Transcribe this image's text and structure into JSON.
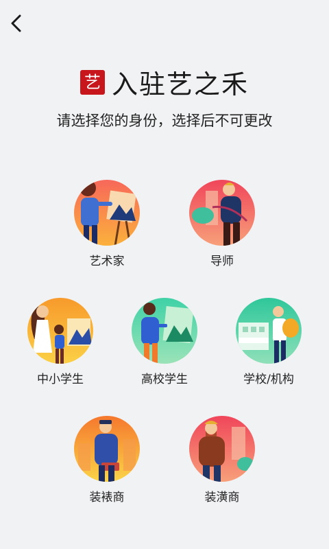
{
  "header": {
    "back_icon": "chevron-left-icon"
  },
  "brand": {
    "logo_char": "艺",
    "title": "入驻艺之禾",
    "logo_color": "#c8161d"
  },
  "subtitle": "请选择您的身份，选择后不可更改",
  "roles": [
    {
      "label": "艺术家"
    },
    {
      "label": "导师"
    },
    {
      "label": "中小学生"
    },
    {
      "label": "高校学生"
    },
    {
      "label": "学校/机构"
    },
    {
      "label": "装裱商"
    },
    {
      "label": "装潢商"
    }
  ]
}
